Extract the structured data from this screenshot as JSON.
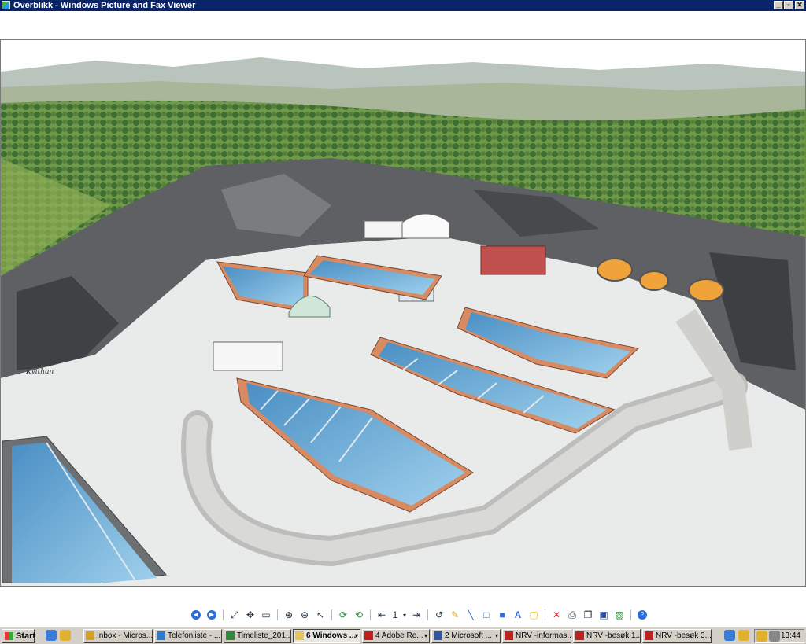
{
  "window": {
    "title": "Overblikk - Windows Picture and Fax Viewer",
    "controls": {
      "minimize": "_",
      "restore": "▫",
      "close": "✕"
    }
  },
  "picture": {
    "signature_text": "Kvithan"
  },
  "viewer_toolbar": {
    "page_number": "1",
    "icons": [
      "previous-image-icon",
      "next-image-icon",
      "best-fit-icon",
      "actual-size-icon",
      "slideshow-icon",
      "zoom-in-icon",
      "zoom-out-icon",
      "pointer-icon",
      "rotate-clockwise-icon",
      "rotate-counterclockwise-icon",
      "first-page-icon",
      "page-dropdown-icon",
      "last-page-icon",
      "new-annotation-icon",
      "freehand-icon",
      "highlighter-icon",
      "line-icon",
      "rectangle-icon",
      "filled-rectangle-icon",
      "text-icon",
      "note-icon",
      "delete-icon",
      "print-icon",
      "copy-icon",
      "save-icon",
      "edit-icon",
      "help-icon"
    ]
  },
  "taskbar": {
    "start_label": "Start",
    "tasks": [
      {
        "label": "Inbox - Micros...",
        "icon": "outlook-icon",
        "color": "#d8a020"
      },
      {
        "label": "Telefonliste - ...",
        "icon": "ie-icon",
        "color": "#2a7bd1"
      },
      {
        "label": "Timeliste_201...",
        "icon": "excel-icon",
        "color": "#2e8b3e"
      },
      {
        "label": "6 Windows ...",
        "icon": "folder-icon",
        "color": "#e7c45a"
      },
      {
        "label": "4 Adobe Re...",
        "icon": "pdf-icon",
        "color": "#c02020"
      },
      {
        "label": "2 Microsoft ...",
        "icon": "word-icon",
        "color": "#2f55a4"
      },
      {
        "label": "NRV -informas...",
        "icon": "pdf-icon",
        "color": "#c02020"
      },
      {
        "label": "NRV -besøk 1...",
        "icon": "pdf-icon",
        "color": "#c02020"
      },
      {
        "label": "NRV -besøk 3...",
        "icon": "pdf-icon",
        "color": "#c02020"
      }
    ],
    "clock": "13:44"
  }
}
